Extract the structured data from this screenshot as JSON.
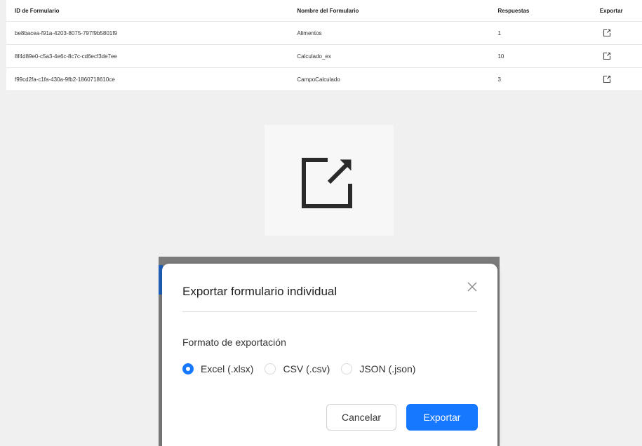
{
  "table": {
    "headers": {
      "id": "ID de Formulario",
      "name": "Nombre del Formulario",
      "responses": "Respuestas",
      "export": "Exportar"
    },
    "rows": [
      {
        "id": "be8bacea-f91a-4203-8075-797f9b5801f9",
        "name": "Alimentos",
        "responses": "1"
      },
      {
        "id": "8f4d89e0-c5a3-4e6c-8c7c-cd6ecf3de7ee",
        "name": "Calculado_ex",
        "responses": "10"
      },
      {
        "id": "f99cd2fa-c1fa-430a-9fb2-1860718610ce",
        "name": "CampoCalculado",
        "responses": "3"
      }
    ],
    "row_icon": "external-link-icon"
  },
  "preview": {
    "icon": "external-link-icon"
  },
  "modal": {
    "title": "Exportar formulario individual",
    "format_label": "Formato de exportación",
    "options": [
      {
        "label": "Excel (.xlsx)",
        "selected": true
      },
      {
        "label": "CSV (.csv)",
        "selected": false
      },
      {
        "label": "JSON (.json)",
        "selected": false
      }
    ],
    "cancel_label": "Cancelar",
    "export_label": "Exportar",
    "close_icon": "close-icon"
  },
  "colors": {
    "primary": "#1677ff",
    "backdrop": "#7b7b7b",
    "page_bg": "#f0f0f0"
  }
}
